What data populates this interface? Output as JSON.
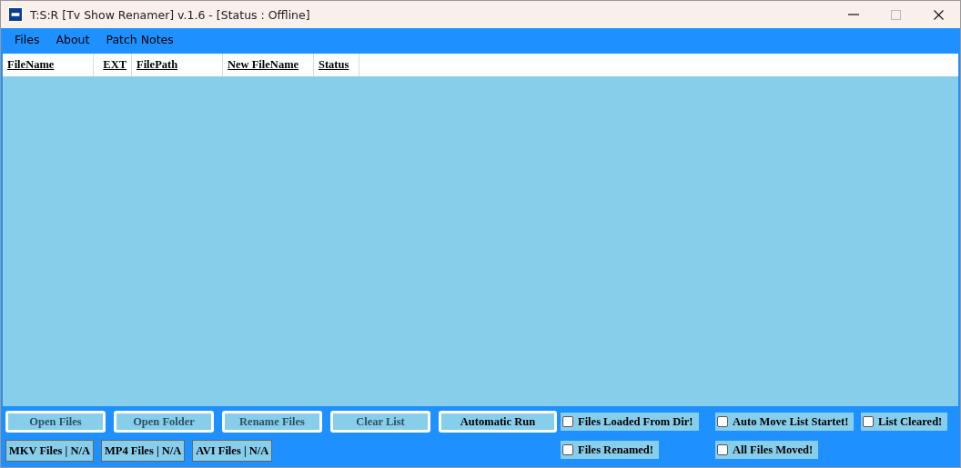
{
  "window": {
    "title": "T:S:R [Tv Show Renamer] v.1.6 - [Status : Offline]"
  },
  "menu": [
    "Files",
    "About",
    "Patch Notes"
  ],
  "table": {
    "columns": [
      "FileName",
      "EXT",
      "FilePath",
      "New FileName",
      "Status"
    ]
  },
  "buttons": [
    {
      "label": "Open Files",
      "disabled": true
    },
    {
      "label": "Open Folder",
      "disabled": true
    },
    {
      "label": "Rename Files",
      "disabled": true
    },
    {
      "label": "Clear List",
      "disabled": true
    },
    {
      "label": "Automatic Run",
      "disabled": false
    }
  ],
  "file_counts": [
    "MKV Files | N/A",
    "MP4 Files | N/A",
    "AVI Files | N/A"
  ],
  "status_checks": [
    {
      "label": "Files Loaded From Dir!",
      "checked": false
    },
    {
      "label": "Auto Move List Startet!",
      "checked": false
    },
    {
      "label": "List Cleared!",
      "checked": false
    },
    {
      "label": "Files Renamed!",
      "checked": false
    },
    {
      "label": "All Files Moved!",
      "checked": false
    }
  ]
}
